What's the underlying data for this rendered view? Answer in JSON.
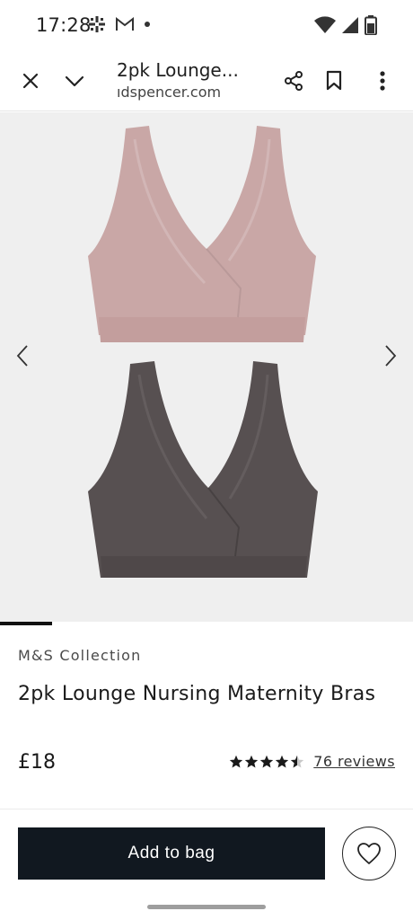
{
  "status_bar": {
    "time": "17:28",
    "left_icons": [
      "pinwheel-icon",
      "gmail-icon",
      "dot-icon"
    ],
    "right_icons": [
      "wifi-icon",
      "signal-icon",
      "battery-icon"
    ]
  },
  "browser": {
    "page_title": "2pk Lounge...",
    "url": "ıdspencer.com",
    "icons": [
      "close-icon",
      "chevron-down-icon",
      "share-icon",
      "bookmark-icon",
      "more-vert-icon"
    ]
  },
  "gallery": {
    "colors": {
      "top_bra": "#c9a7a6",
      "bottom_bra": "#575051",
      "background": "#efefef"
    },
    "progress_fraction": 0.125,
    "arrows": [
      "chevron-left-icon",
      "chevron-right-icon"
    ]
  },
  "product": {
    "brand": "M&S Collection",
    "title": "2pk Lounge Nursing Maternity Bras",
    "price": "£18",
    "rating": 4.5,
    "reviews_label": "76 reviews"
  },
  "actions": {
    "add_to_bag_label": "Add to bag",
    "wishlist_icon": "heart-icon",
    "accent": "#111820"
  }
}
